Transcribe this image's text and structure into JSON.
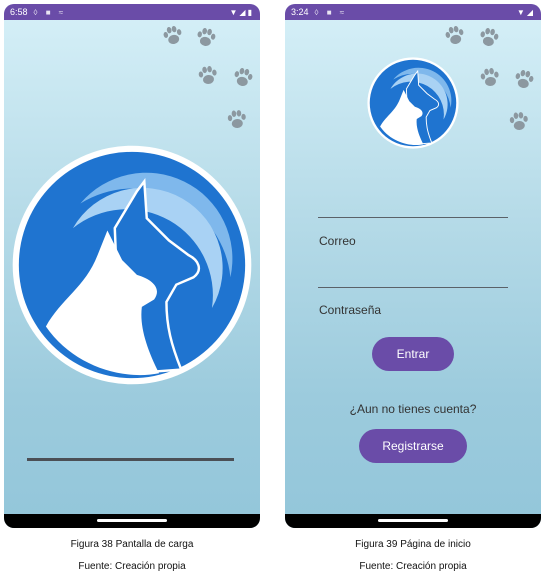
{
  "splash": {
    "status_time": "6:58"
  },
  "login": {
    "status_time": "3:24",
    "email_label": "Correo",
    "password_label": "Contraseña",
    "enter_button": "Entrar",
    "no_account_text": "¿Aun no tienes cuenta?",
    "register_button": "Registrarse"
  },
  "captions": {
    "left_title": "Figura 38 Pantalla de carga",
    "left_source": "Fuente: Creación propia",
    "right_title": "Figura 39 Página de inicio",
    "right_source": "Fuente: Creación propia"
  },
  "colors": {
    "accent": "#6a4ca8",
    "logo_blue": "#1f74d0"
  },
  "icons": [
    "paw-icon",
    "pet-logo-icon",
    "wifi-icon",
    "signal-icon",
    "battery-icon"
  ]
}
